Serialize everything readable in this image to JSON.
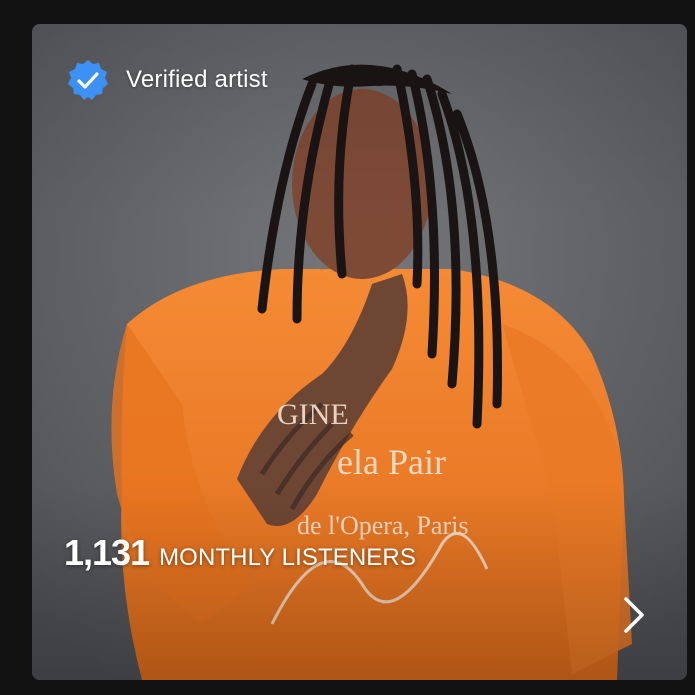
{
  "card": {
    "verified_label": "Verified artist",
    "listeners_count": "1,131",
    "listeners_label": "MONTHLY LISTENERS",
    "photo_alt": "Artist photo"
  },
  "icons": {
    "verified": "verified-badge-icon",
    "next": "chevron-right-icon"
  },
  "colors": {
    "background": "#121212",
    "verified_badge": "#3d91f4",
    "text": "#ffffff",
    "sweater": "#f07a24"
  }
}
